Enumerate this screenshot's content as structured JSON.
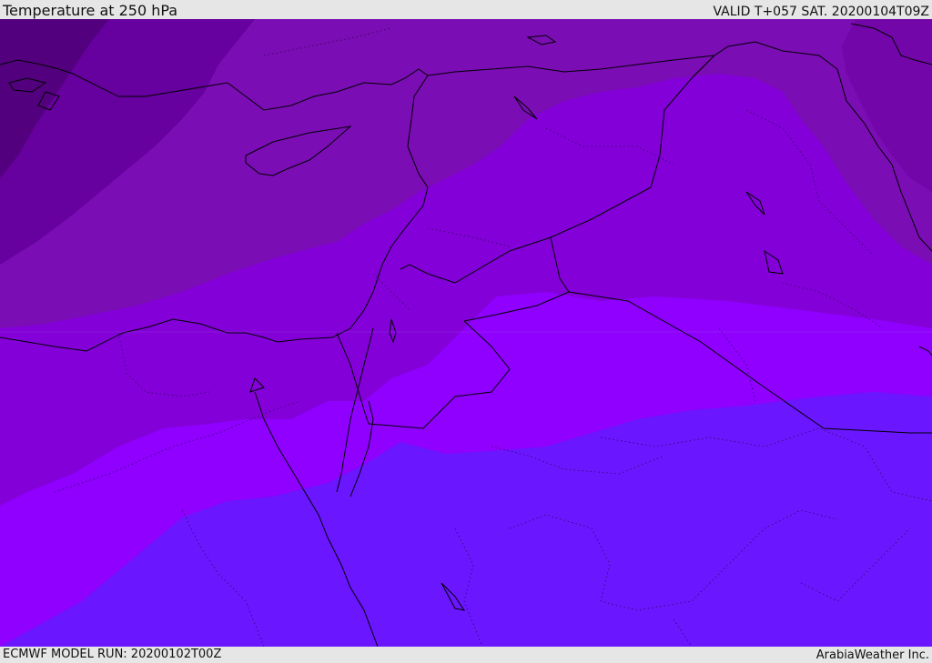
{
  "header": {
    "title": "Temperature at 250 hPa",
    "valid_time": "VALID T+057 SAT. 20200104T09Z"
  },
  "footer": {
    "model_run": "ECMWF MODEL RUN: 20200102T00Z",
    "credit": "ArabiaWeather Inc."
  },
  "colors": {
    "band_darkest": "#53007f",
    "band_dark": "#66009e",
    "band_mid": "#7a0db3",
    "band_violet": "#8300d9",
    "band_bright": "#8f00ff",
    "band_blue": "#6a16ff",
    "coastline": "#000000",
    "borders": "#000000"
  }
}
